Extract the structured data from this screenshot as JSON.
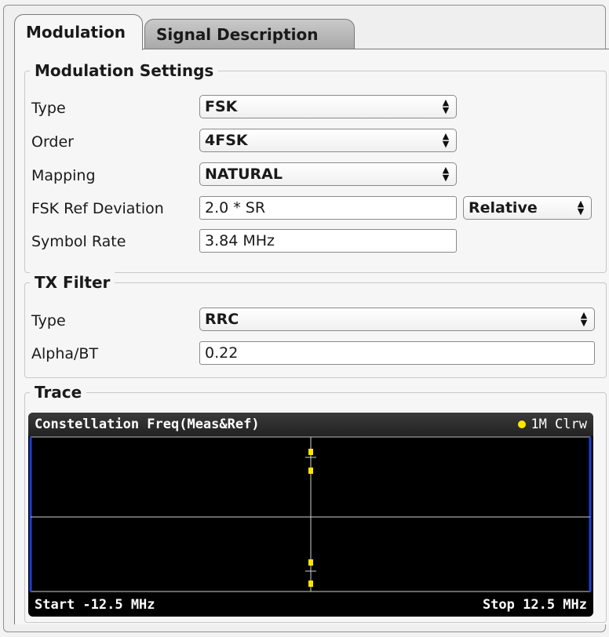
{
  "tabs": [
    {
      "label": "Modulation",
      "active": true
    },
    {
      "label": "Signal Description",
      "active": false
    }
  ],
  "modulation_settings": {
    "title": "Modulation Settings",
    "type": {
      "label": "Type",
      "value": "FSK"
    },
    "order": {
      "label": "Order",
      "value": "4FSK"
    },
    "mapping": {
      "label": "Mapping",
      "value": "NATURAL"
    },
    "fsk_ref_deviation": {
      "label": "FSK Ref Deviation",
      "value": "2.0 * SR",
      "unit_mode": "Relative"
    },
    "symbol_rate": {
      "label": "Symbol Rate",
      "value": "3.84 MHz"
    }
  },
  "tx_filter": {
    "title": "TX Filter",
    "type": {
      "label": "Type",
      "value": "RRC"
    },
    "alpha_bt": {
      "label": "Alpha/BT",
      "value": "0.22"
    }
  },
  "trace": {
    "title": "Trace",
    "chart_title": "Constellation Freq(Meas&Ref)",
    "badge": "1M Clrw",
    "start_label": "Start -12.5 MHz",
    "stop_label": "Stop 12.5 MHz",
    "trace_color": "#ffe600"
  }
}
